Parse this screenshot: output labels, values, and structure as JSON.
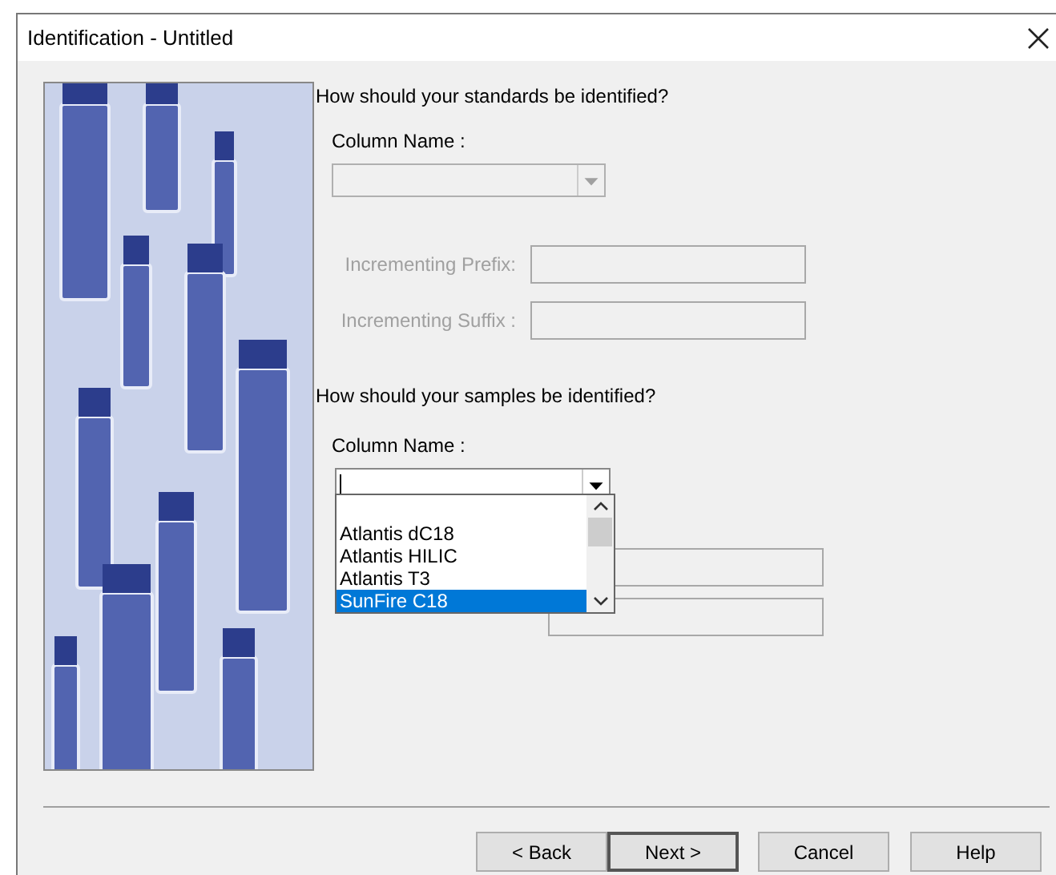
{
  "window": {
    "title": "Identification - Untitled"
  },
  "standards": {
    "question": "How should your standards be identified?",
    "column_label": "Column Name :",
    "disabled": true,
    "prefix_label": "Incrementing Prefix:",
    "suffix_label": "Incrementing Suffix :"
  },
  "samples": {
    "question": "How should your samples be identified?",
    "column_label": "Column Name :",
    "expanded": true,
    "options": [
      {
        "label": "Atlantis dC18",
        "selected": false
      },
      {
        "label": "Atlantis HILIC",
        "selected": false
      },
      {
        "label": "Atlantis T3",
        "selected": false
      },
      {
        "label": "SunFire C18",
        "selected": true
      }
    ]
  },
  "buttons": [
    {
      "label": "< Back",
      "default": false
    },
    {
      "label": "Next >",
      "default": true
    },
    {
      "label": "Cancel",
      "default": false
    },
    {
      "label": "Help",
      "default": false
    }
  ]
}
